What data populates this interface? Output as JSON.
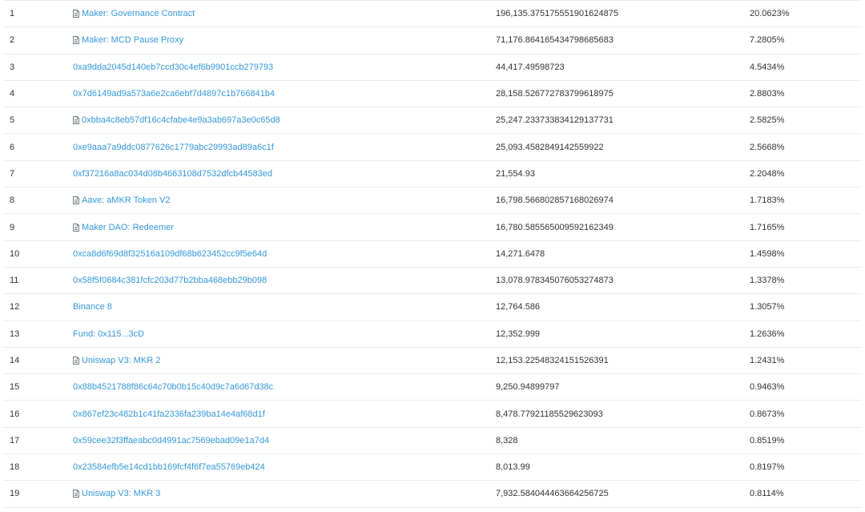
{
  "holders": [
    {
      "rank": "1",
      "address": "Maker: Governance Contract",
      "is_contract": true,
      "quantity": "196,135.375175551901624875",
      "percentage": "20.0623%"
    },
    {
      "rank": "2",
      "address": "Maker: MCD Pause Proxy",
      "is_contract": true,
      "quantity": "71,176.864165434798685683",
      "percentage": "7.2805%"
    },
    {
      "rank": "3",
      "address": "0xa9dda2045d140eb7ccd30c4ef6b9901ccb279793",
      "is_contract": false,
      "quantity": "44,417.49598723",
      "percentage": "4.5434%"
    },
    {
      "rank": "4",
      "address": "0x7d6149ad9a573a6e2ca6ebf7d4897c1b766841b4",
      "is_contract": false,
      "quantity": "28,158.526772783799618975",
      "percentage": "2.8803%"
    },
    {
      "rank": "5",
      "address": "0xbba4c8eb57df16c4cfabe4e9a3ab697a3e0c65d8",
      "is_contract": true,
      "quantity": "25,247.233733834129137731",
      "percentage": "2.5825%"
    },
    {
      "rank": "6",
      "address": "0xe9aaa7a9ddc0877626c1779abc29993ad89a6c1f",
      "is_contract": false,
      "quantity": "25,093.4582849142559922",
      "percentage": "2.5668%"
    },
    {
      "rank": "7",
      "address": "0xf37216a8ac034d08b4663108d7532dfcb44583ed",
      "is_contract": false,
      "quantity": "21,554.93",
      "percentage": "2.2048%"
    },
    {
      "rank": "8",
      "address": "Aave: aMKR Token V2",
      "is_contract": true,
      "quantity": "16,798.566802857168026974",
      "percentage": "1.7183%"
    },
    {
      "rank": "9",
      "address": "Maker DAO: Redeemer",
      "is_contract": true,
      "quantity": "16,780.585565009592162349",
      "percentage": "1.7165%"
    },
    {
      "rank": "10",
      "address": "0xca8d6f69d8f32516a109df68b623452cc9f5e64d",
      "is_contract": false,
      "quantity": "14,271.6478",
      "percentage": "1.4598%"
    },
    {
      "rank": "11",
      "address": "0x58f5f0684c381fcfc203d77b2bba468ebb29b098",
      "is_contract": false,
      "quantity": "13,078.978345076053274873",
      "percentage": "1.3378%"
    },
    {
      "rank": "12",
      "address": "Binance 8",
      "is_contract": false,
      "quantity": "12,764.586",
      "percentage": "1.3057%"
    },
    {
      "rank": "13",
      "address": "Fund: 0x115...3cD",
      "is_contract": false,
      "quantity": "12,352.999",
      "percentage": "1.2636%"
    },
    {
      "rank": "14",
      "address": "Uniswap V3: MKR 2",
      "is_contract": true,
      "quantity": "12,153.22548324151526391",
      "percentage": "1.2431%"
    },
    {
      "rank": "15",
      "address": "0x88b4521788f86c64c70b0b15c40d9c7a6d67d38c",
      "is_contract": false,
      "quantity": "9,250.94899797",
      "percentage": "0.9463%"
    },
    {
      "rank": "16",
      "address": "0x867ef23c482b1c41fa2336fa239ba14e4af68d1f",
      "is_contract": false,
      "quantity": "8,478.77921185529623093",
      "percentage": "0.8673%"
    },
    {
      "rank": "17",
      "address": "0x59cee32f3ffaeabc0d4991ac7569ebad09e1a7d4",
      "is_contract": false,
      "quantity": "8,328",
      "percentage": "0.8519%"
    },
    {
      "rank": "18",
      "address": "0x23584efb5e14cd1bb169fcf4f6f7ea55769eb424",
      "is_contract": false,
      "quantity": "8,013.99",
      "percentage": "0.8197%"
    },
    {
      "rank": "19",
      "address": "Uniswap V3: MKR 3",
      "is_contract": true,
      "quantity": "7,932.584044463664256725",
      "percentage": "0.8114%"
    }
  ],
  "colors": {
    "link": "#3498db",
    "text": "#333333",
    "row_border": "#e9ecef",
    "icon": "#6c757d"
  },
  "icons": {
    "contract": "document-icon"
  }
}
